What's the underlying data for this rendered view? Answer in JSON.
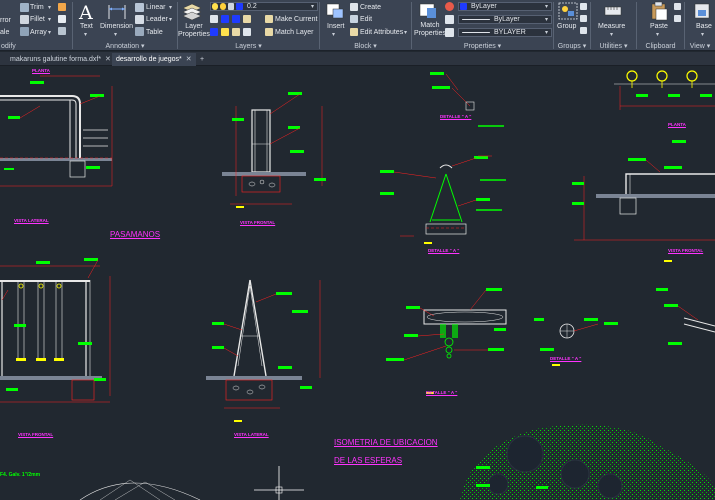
{
  "ribbon": {
    "modify": {
      "title": "odify",
      "items": [
        "rror",
        "Trim",
        "Fillet",
        "Array",
        "ale"
      ]
    },
    "annotation": {
      "title": "Annotation",
      "text_label": "Text",
      "dimension_label": "Dimension",
      "linear_label": "Linear",
      "leader_label": "Leader",
      "table_label": "Table"
    },
    "layers": {
      "title": "Layers",
      "layer_properties_label": "Layer\nProperties",
      "current_layer_value": "0.2",
      "make_current_label": "Make Current",
      "match_layer_label": "Match Layer"
    },
    "block": {
      "title": "Block",
      "insert_label": "Insert",
      "create_label": "Create",
      "edit_label": "Edit",
      "edit_attributes_label": "Edit Attributes"
    },
    "properties": {
      "title": "Properties",
      "match_properties_label": "Match\nProperties",
      "color_value": "ByLayer",
      "linetype_value": "ByLayer",
      "lineweight_value": "BYLAYER"
    },
    "groups": {
      "title": "Groups",
      "group_label": "Group"
    },
    "utilities": {
      "title": "Utilities",
      "measure_label": "Measure"
    },
    "clipboard": {
      "title": "Clipboard",
      "paste_label": "Paste"
    },
    "view": {
      "title": "View",
      "base_label": "Base"
    }
  },
  "tabs": [
    {
      "label": "makaruns galutine forma.dxf*",
      "active": false
    },
    {
      "label": "desarrollo de juegos*",
      "active": true
    }
  ],
  "tab_close_glyph": "✕",
  "tab_add_glyph": "+",
  "drawing": {
    "labels": {
      "planta_top": "PLANTA",
      "vista_lateral_1": "VISTA LATERAL",
      "vista_frontal_1": "VISTA FRONTAL",
      "detalle_a_1": "DETALLE \" A \"",
      "planta_right": "PLANTA",
      "pasamanos": "PASAMANOS",
      "detalle_a_2": "DETALLE \" A \"",
      "vista_frontal_right": "VISTA FRONTAL",
      "vista_frontal_2": "VISTA FRONTAL",
      "vista_lateral_2": "VISTA LATERAL",
      "detalle_a_3": "DETALLE \" A \"",
      "detalle_a_4": "DETALLE \" A \"",
      "isometria_1": "ISOMETRIA DE UBICACION",
      "isometria_2": "DE LAS ESFERAS",
      "note_bottom": "F4. Galv. 1\"/2mm"
    }
  },
  "colors": {
    "ribbon_bg": "#3b4453",
    "canvas_bg": "#212830",
    "cad_green": "#00ff00",
    "cad_red": "#ff2020",
    "cad_yellow": "#ffff00",
    "cad_magenta": "#ff33ff",
    "cad_white": "#e8e8e8"
  }
}
